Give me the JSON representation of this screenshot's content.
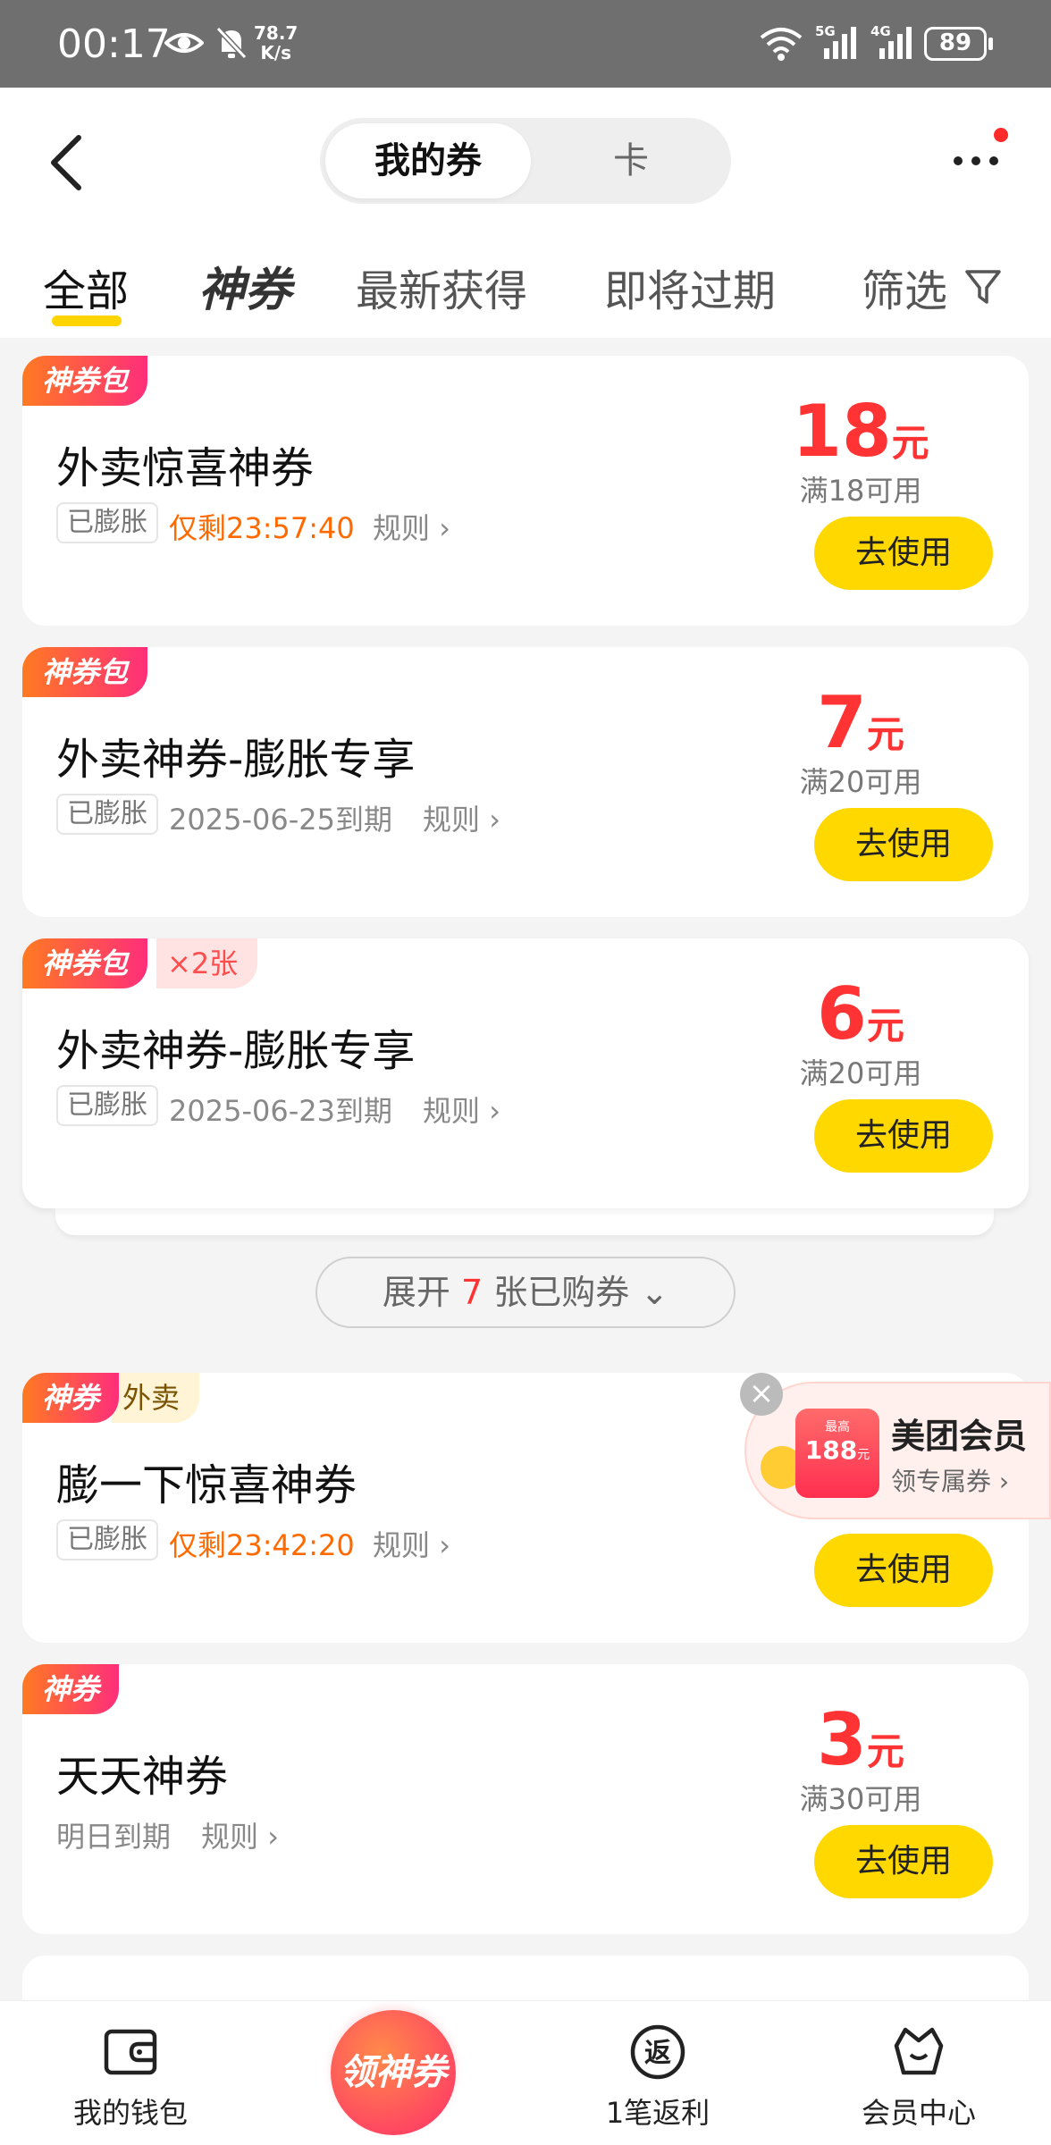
{
  "status_bar": {
    "time": "00:17",
    "speed_top": "78.7",
    "speed_bottom": "K/s",
    "net1": "5G",
    "net2": "4G",
    "battery": "89"
  },
  "header": {
    "segments": [
      "我的券",
      "卡"
    ],
    "active_segment": "我的券"
  },
  "tabs": {
    "all": "全部",
    "shen": "神券",
    "newest": "最新获得",
    "expiring": "即将过期",
    "filter": "筛选"
  },
  "coupons": [
    {
      "badge": "神券包",
      "title": "外卖惊喜神券",
      "tag": "已膨胀",
      "meta": "仅剩23:57:40",
      "rule": "规则",
      "amount": "18",
      "unit": "元",
      "condition": "满18可用",
      "button": "去使用"
    },
    {
      "badge": "神券包",
      "title": "外卖神券-膨胀专享",
      "tag": "已膨胀",
      "meta": "2025-06-25到期",
      "rule": "规则",
      "amount": "7",
      "unit": "元",
      "condition": "满20可用",
      "button": "去使用"
    },
    {
      "badge": "神券包",
      "badge_extra": "×2张",
      "title": "外卖神券-膨胀专享",
      "tag": "已膨胀",
      "meta": "2025-06-23到期",
      "rule": "规则",
      "amount": "6",
      "unit": "元",
      "condition": "满20可用",
      "button": "去使用"
    },
    {
      "badge": "神券",
      "badge_extra": "外卖",
      "title": "膨一下惊喜神券",
      "tag": "已膨胀",
      "meta": "仅剩23:42:20",
      "rule": "规则",
      "button": "去使用"
    },
    {
      "badge": "神券",
      "title": "天天神券",
      "meta": "明日到期",
      "rule": "规则",
      "amount": "3",
      "unit": "元",
      "condition": "满30可用",
      "button": "去使用"
    }
  ],
  "expand": {
    "prefix": "展开",
    "count": "7",
    "suffix": "张已购券"
  },
  "member_popup": {
    "card_small": "最高",
    "card_big": "188",
    "card_unit": "元",
    "title": "美团会员",
    "subtitle": "领专属券"
  },
  "bottom_nav": {
    "wallet": "我的钱包",
    "center": "领神券",
    "rebate_icon": "返",
    "rebate": "1笔返利",
    "member": "会员中心"
  },
  "colors": {
    "accent_yellow": "#ffd800",
    "price_red": "#ff3333",
    "countdown_orange": "#ff6a00",
    "badge_gradient_start": "#ff7a22",
    "badge_gradient_end": "#ff2e7a"
  }
}
